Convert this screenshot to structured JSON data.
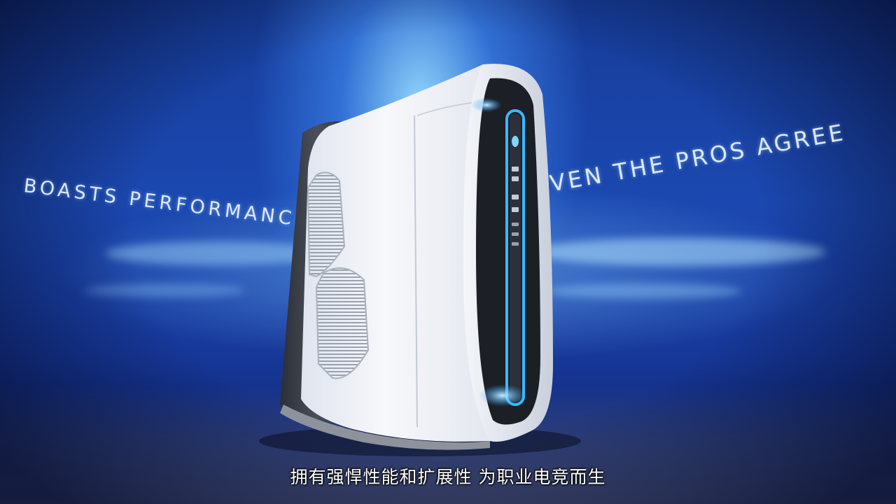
{
  "headline_left": "BOASTS PERFORMANCE",
  "headline_right": "EVEN THE PROS AGREE",
  "subtitle": "拥有强悍性能和扩展性  为职业电竞而生",
  "colors": {
    "background": "#1b48b0",
    "glow": "#9fdcff",
    "case_body": "#f2f4f8",
    "case_side": "#3a3d44",
    "accent_light": "#38b6ff"
  },
  "icons": [
    "alien-logo-icon"
  ]
}
